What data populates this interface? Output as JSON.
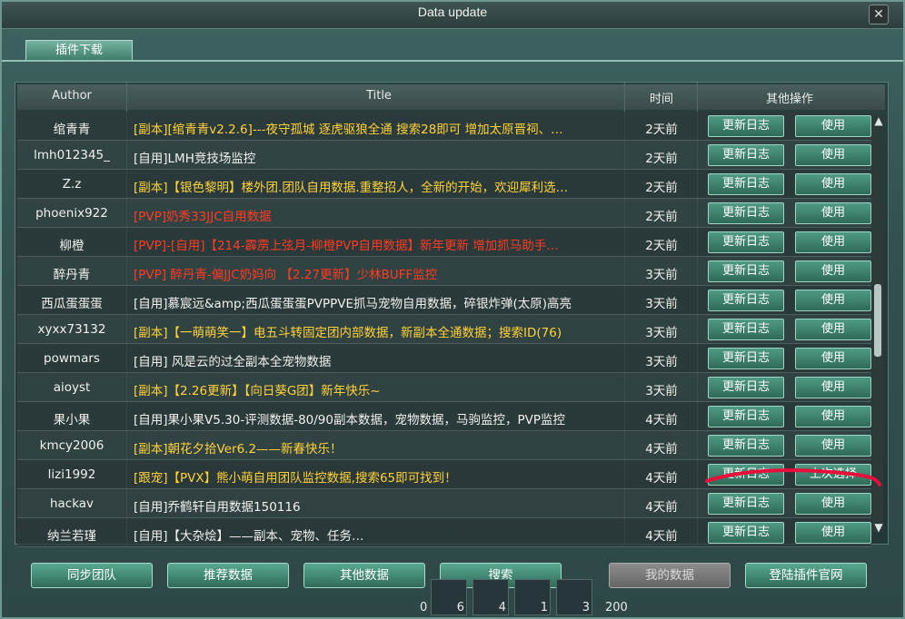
{
  "window": {
    "title": "Data update",
    "close_label": "✕"
  },
  "tabs": [
    {
      "label": "插件下载",
      "active": true
    }
  ],
  "table": {
    "headers": {
      "author": "Author",
      "title": "Title",
      "time": "时间",
      "actions": "其他操作"
    },
    "rows": [
      {
        "author": "绾青青",
        "title": "[副本][绾青青v2.2.6]---夜守孤城 逐虎驱狼全通  搜索28即可 增加太原晋祠、…",
        "color": "yellow",
        "time": "2天前",
        "log": "更新日志",
        "use": "使用"
      },
      {
        "author": "lmh012345_",
        "title": "[自用]LMH竞技场监控",
        "color": "white",
        "time": "2天前",
        "log": "更新日志",
        "use": "使用"
      },
      {
        "author": "Z.z",
        "title": "[副本]【银色黎明】楼外团.团队自用数据.重整招人，全新的开始，欢迎犀利选…",
        "color": "yellow",
        "time": "2天前",
        "log": "更新日志",
        "use": "使用"
      },
      {
        "author": "phoenix922",
        "title": "[PVP]奶秀33JJC自用数据",
        "color": "red",
        "time": "2天前",
        "log": "更新日志",
        "use": "使用"
      },
      {
        "author": "柳橙",
        "title": "[PVP]-[自用]【214-霹雳上弦月-柳橙PVP自用数据】新年更新 增加抓马助手…",
        "color": "red",
        "time": "2天前",
        "log": "更新日志",
        "use": "使用"
      },
      {
        "author": "醉丹青",
        "title": "[PVP] 醉丹青-偏JJC奶妈向 【2.27更新】少林BUFF监控",
        "color": "red",
        "time": "3天前",
        "log": "更新日志",
        "use": "使用"
      },
      {
        "author": "西瓜蛋蛋蛋",
        "title": "[自用]慕宸远&amp;西瓜蛋蛋蛋PVPPVE抓马宠物自用数据，碎银炸弹(太原)高亮",
        "color": "white",
        "time": "3天前",
        "log": "更新日志",
        "use": "使用"
      },
      {
        "author": "xyxx73132",
        "title": "[副本]【一萌萌笑一】电五斗转固定团内部数据，新副本全通数据；搜索ID(76)",
        "color": "yellow",
        "time": "3天前",
        "log": "更新日志",
        "use": "使用"
      },
      {
        "author": "powmars",
        "title": "[自用] 风是云的过全副本全宠物数据",
        "color": "white",
        "time": "3天前",
        "log": "更新日志",
        "use": "使用"
      },
      {
        "author": "aioyst",
        "title": "[副本]【2.26更新】【向日葵G团】新年快乐~",
        "color": "yellow",
        "time": "3天前",
        "log": "更新日志",
        "use": "使用"
      },
      {
        "author": "果小果",
        "title": "[自用]果小果V5.30-评测数据-80/90副本数据，宠物数据，马驹监控，PVP监控",
        "color": "white",
        "time": "4天前",
        "log": "更新日志",
        "use": "使用"
      },
      {
        "author": "kmcy2006",
        "title": "[副本]朝花夕拾Ver6.2——新春快乐！",
        "color": "yellow",
        "time": "4天前",
        "log": "更新日志",
        "use": "使用"
      },
      {
        "author": "lizi1992",
        "title": "[跟宠]【PVX】熊小萌自用团队监控数据,搜索65即可找到！",
        "color": "yellow",
        "time": "4天前",
        "log": "更新日志",
        "use": "上次选择"
      },
      {
        "author": "hackav",
        "title": "[自用]乔鹤轩自用数据150116",
        "color": "white",
        "time": "4天前",
        "log": "更新日志",
        "use": "使用"
      },
      {
        "author": "纳兰若瑾",
        "title": "[自用]【大杂烩】——副本、宠物、任务…",
        "color": "white",
        "time": "4天前",
        "log": "更新日志",
        "use": "使用"
      }
    ]
  },
  "bottom_buttons": [
    {
      "label": "同步团队",
      "disabled": false
    },
    {
      "label": "推荐数据",
      "disabled": false
    },
    {
      "label": "其他数据",
      "disabled": false
    },
    {
      "label": "搜索",
      "disabled": false
    },
    {
      "label": "我的数据",
      "disabled": true
    },
    {
      "label": "登陆插件官网",
      "disabled": false
    }
  ],
  "hotbar": {
    "counts": [
      "0",
      "6",
      "4",
      "1",
      "3",
      "200"
    ]
  },
  "icons": {
    "scroll_up": "▲",
    "scroll_down": "▼"
  },
  "colors": {
    "title_yellow": "#ffd23a",
    "title_red": "#ff3b23",
    "title_white": "#f1f1ee",
    "button_green": "#3f806c",
    "annotation_red": "#e8103a"
  }
}
